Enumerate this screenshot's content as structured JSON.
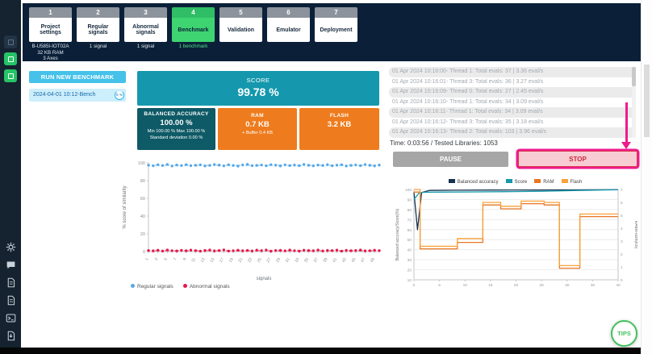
{
  "sidebar": {
    "top_icons": [
      "app-logo-icon",
      "project-indicator-icon",
      "project-indicator-icon"
    ],
    "bottom_icons": [
      "settings-icon",
      "chat-icon",
      "document-icon",
      "document-icon",
      "terminal-icon",
      "export-icon"
    ]
  },
  "header": {
    "steps": [
      {
        "num": "1",
        "label": "Project settings",
        "sub": [
          "B-U585I-IOT02A",
          "32 KB RAM",
          "3 Axes"
        ]
      },
      {
        "num": "2",
        "label": "Regular signals",
        "sub": [
          "1 signal"
        ]
      },
      {
        "num": "3",
        "label": "Abnormal signals",
        "sub": [
          "1 signal"
        ]
      },
      {
        "num": "4",
        "label": "Benchmark",
        "sub": [
          "1 benchmark"
        ]
      },
      {
        "num": "5",
        "label": "Validation",
        "sub": []
      },
      {
        "num": "6",
        "label": "Emulator",
        "sub": []
      },
      {
        "num": "7",
        "label": "Deployment",
        "sub": []
      }
    ]
  },
  "benchmark_panel": {
    "run_button_label": "RUN NEW BENCHMARK",
    "item_name": "2024-04-01 10:12-Bench",
    "item_progress": "6 %"
  },
  "score_card": {
    "title": "SCORE",
    "value": "99.78 %"
  },
  "metrics": {
    "balanced": {
      "title": "BALANCED ACCURACY",
      "value": "100.00 %",
      "line1": "Min 100.00 % Max 100.00 %",
      "line2": "Standard deviation 0.00 %"
    },
    "ram": {
      "title": "RAM",
      "value": "0.7 KB",
      "line1": "+ Buffer 0.4 KB"
    },
    "flash": {
      "title": "FLASH",
      "value": "3.2 KB"
    }
  },
  "log": {
    "lines": [
      "01 Apr 2024 10:16:00- Thread 1: Total evals: 37 | 3.36 eval/s",
      "01 Apr 2024 10:16:01- Thread 3: Total evals: 36 | 3.27 eval/s",
      "01 Apr 2024 10:16:09- Thread 0: Total evals: 27 | 2.45 eval/s",
      "01 Apr 2024 10:16:10- Thread 1: Total evals: 34 | 3.09 eval/s",
      "01 Apr 2024 10:16:11- Thread 1: Total evals: 34 | 3.09 eval/s",
      "01 Apr 2024 10:16:12- Thread 3: Total evals: 35 | 3.18 eval/s",
      "01 Apr 2024 10:16:13- Thread 2: Total evals: 103 | 3.96 eval/s"
    ],
    "status": "Time: 0:03:56 / Tested Libraries: 1053"
  },
  "controls": {
    "pause_label": "PAUSE",
    "stop_label": "STOP"
  },
  "tips_label": "TIPS",
  "colors": {
    "accent_blue": "#45c1ea",
    "teal": "#1598ad",
    "dark_teal": "#0e5a66",
    "orange": "#ee7c1e",
    "active_green": "#3fd472",
    "magenta_annotation": "#ef1a8d",
    "stop_red": "#d93a4a",
    "header_navy": "#0b2038"
  },
  "chart_data": [
    {
      "type": "scatter",
      "xlabel": "signals",
      "ylabel": "% score of similarity",
      "ylim": [
        0,
        100
      ],
      "yticks": [
        0,
        20,
        40,
        60,
        80,
        100
      ],
      "xticks": [
        1,
        3,
        5,
        7,
        9,
        11,
        13,
        15,
        17,
        19,
        21,
        23,
        25,
        27,
        29,
        31,
        33,
        35,
        37,
        39,
        41,
        43,
        45,
        47,
        49
      ],
      "x": [
        1,
        2,
        3,
        4,
        5,
        6,
        7,
        8,
        9,
        10,
        11,
        12,
        13,
        14,
        15,
        16,
        17,
        18,
        19,
        20,
        21,
        22,
        23,
        24,
        25,
        26,
        27,
        28,
        29,
        30,
        31,
        32,
        33,
        34,
        35,
        36,
        37,
        38,
        39,
        40,
        41,
        42,
        43,
        44,
        45,
        46,
        47,
        48,
        49,
        50
      ],
      "series": [
        {
          "name": "Regular signals",
          "color": "#56a8e8",
          "values": [
            97.4,
            96.8,
            97.9,
            97.1,
            98.2,
            96.5,
            97.6,
            97.0,
            98.0,
            96.9,
            97.3,
            97.8,
            96.6,
            97.2,
            98.1,
            97.5,
            96.7,
            97.9,
            97.1,
            96.4,
            97.7,
            98.3,
            96.9,
            97.2,
            97.6,
            96.8,
            98.0,
            97.4,
            96.6,
            97.8,
            97.0,
            97.5,
            96.9,
            98.2,
            97.3,
            96.7,
            97.6,
            97.1,
            98.0,
            96.8,
            97.4,
            97.9,
            96.5,
            97.2,
            97.7,
            96.9,
            98.1,
            97.3,
            96.6,
            97.5
          ]
        },
        {
          "name": "Abnormal signals",
          "color": "#e8174b",
          "values": [
            1.2,
            0.8,
            1.5,
            0.6,
            1.8,
            1.0,
            0.7,
            1.4,
            0.9,
            1.6,
            1.1,
            0.5,
            1.3,
            1.7,
            0.8,
            1.2,
            1.9,
            0.6,
            1.0,
            1.5,
            0.9,
            1.3,
            0.7,
            1.6,
            1.1,
            1.8,
            0.5,
            1.2,
            1.4,
            0.8,
            1.7,
            1.0,
            0.6,
            1.5,
            1.2,
            0.9,
            1.8,
            0.7,
            1.3,
            1.1,
            1.6,
            0.5,
            1.4,
            0.9,
            1.2,
            1.7,
            0.8,
            1.0,
            1.5,
            1.1
          ]
        }
      ],
      "guides": [
        {
          "y": 97.2,
          "color": "#56a8e8"
        },
        {
          "y": 1.0,
          "color": "#e8174b"
        }
      ],
      "legend_position": "bottom"
    },
    {
      "type": "line",
      "xlim": [
        0,
        40
      ],
      "xticks": [
        0,
        5,
        10,
        15,
        20,
        25,
        30,
        35,
        40
      ],
      "ylim_left": [
        10,
        100
      ],
      "yticks_left": [
        10,
        20,
        30,
        40,
        50,
        60,
        70,
        80,
        90,
        100
      ],
      "ylim_right": [
        0,
        7
      ],
      "yticks_right": [
        0,
        1,
        2,
        3,
        4,
        5,
        6,
        7
      ],
      "ylabel_left": "Balanced accuracy/Score(%)",
      "ylabel_right": "RAM/Flash(KB)",
      "grid": true,
      "legend_position": "top",
      "series": [
        {
          "name": "Balanced accuracy",
          "color": "#16324f",
          "axis": "left",
          "points": [
            [
              0,
              97
            ],
            [
              0.7,
              60
            ],
            [
              1.5,
              97
            ],
            [
              3,
              99
            ],
            [
              8,
              99.3
            ],
            [
              15,
              99.4
            ],
            [
              22,
              99.5
            ],
            [
              30,
              99.6
            ],
            [
              40,
              99.8
            ]
          ]
        },
        {
          "name": "Score",
          "color": "#1598ad",
          "axis": "left",
          "points": [
            [
              0,
              90
            ],
            [
              1,
              96.5
            ],
            [
              2,
              97.3
            ],
            [
              6,
              97.4
            ],
            [
              12,
              97.6
            ],
            [
              18,
              97.8
            ],
            [
              25,
              98.2
            ],
            [
              32,
              99.0
            ],
            [
              40,
              99.78
            ]
          ]
        },
        {
          "name": "RAM",
          "color": "#e87722",
          "axis": "right",
          "points": [
            [
              0,
              6.8
            ],
            [
              1.2,
              6.8
            ],
            [
              1.2,
              2.4
            ],
            [
              8.5,
              2.4
            ],
            [
              8.5,
              2.9
            ],
            [
              13.5,
              2.9
            ],
            [
              13.5,
              5.8
            ],
            [
              17,
              5.8
            ],
            [
              17,
              5.5
            ],
            [
              21,
              5.5
            ],
            [
              21,
              5.9
            ],
            [
              25.5,
              5.9
            ],
            [
              25.5,
              5.8
            ],
            [
              28.5,
              5.8
            ],
            [
              28.5,
              0.9
            ],
            [
              32.5,
              0.9
            ],
            [
              32.5,
              4.9
            ],
            [
              40,
              4.9
            ]
          ]
        },
        {
          "name": "Flash",
          "color": "#f9a13a",
          "axis": "right",
          "points": [
            [
              0,
              7.0
            ],
            [
              1.2,
              7.0
            ],
            [
              1.2,
              2.6
            ],
            [
              8.5,
              2.6
            ],
            [
              8.5,
              3.2
            ],
            [
              13.5,
              3.2
            ],
            [
              13.5,
              6.0
            ],
            [
              17,
              6.0
            ],
            [
              17,
              5.7
            ],
            [
              21,
              5.7
            ],
            [
              21,
              6.1
            ],
            [
              25.5,
              6.1
            ],
            [
              25.5,
              6.0
            ],
            [
              28.5,
              6.0
            ],
            [
              28.5,
              1.1
            ],
            [
              32.5,
              1.1
            ],
            [
              32.5,
              5.1
            ],
            [
              40,
              5.1
            ]
          ]
        }
      ]
    }
  ]
}
